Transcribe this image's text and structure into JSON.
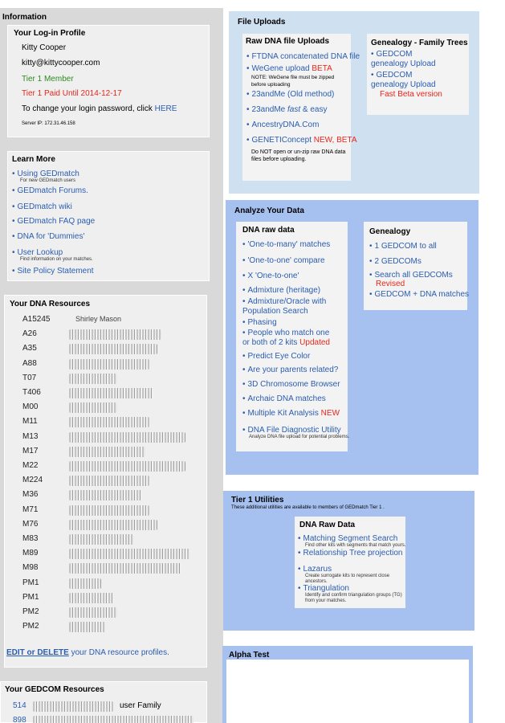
{
  "info": {
    "title": "Information"
  },
  "login": {
    "title": "Your Log-in Profile",
    "name": "Kitty Cooper",
    "email": "kitty@kittycooper.com",
    "tier": "Tier 1 Member",
    "paid": "Tier 1 Paid Until 2014-12-17",
    "pw_text": "To change your login password, click",
    "pw_link": "HERE",
    "server": "Server IP: 172.31.46.158"
  },
  "learn": {
    "title": "Learn More",
    "items": [
      {
        "label": "Using GEDmatch",
        "note": "For new GEDmatch users"
      },
      {
        "label": "GEDmatch Forums."
      },
      {
        "label": "GEDmatch wiki"
      },
      {
        "label": "GEDmatch FAQ page"
      },
      {
        "label": "DNA for 'Dummies'"
      },
      {
        "label": "User Lookup",
        "note": "Find information on your matches."
      },
      {
        "label": "Site Policy Statement"
      }
    ]
  },
  "dna_res": {
    "title": "Your DNA Resources",
    "kits": [
      "A15245",
      "A26",
      "A35",
      "A88",
      "T07",
      "T406",
      "M00",
      "M11",
      "M13",
      "M17",
      "M22",
      "M224",
      "M36",
      "M71",
      "M76",
      "M83",
      "M89",
      "M98",
      "PM1",
      "PM1",
      "PM2",
      "PM2"
    ],
    "first_name": "Shirley Mason",
    "edit_link": "EDIT or DELETE",
    "edit_text": "your DNA resource profiles."
  },
  "gedcom_res": {
    "title": "Your GEDCOM Resources",
    "rows": [
      "514",
      "898"
    ],
    "row1_tail": "user Family"
  },
  "uploads": {
    "title": "File Uploads",
    "raw": {
      "title": "Raw DNA file Uploads",
      "ftdna": "FTDNA concatenated DNA file",
      "wegene": "WeGene upload",
      "beta": "BETA",
      "wegene_note": "NOTE: WeGene file must be zipped before uploading",
      "andme_old": "23andMe (Old method)",
      "andme_fast_a": "23andMe",
      "andme_fast_b": "fast",
      "andme_fast_c": "& easy",
      "ancestry": "AncestryDNA.Com",
      "geneti": "GENETIConcept",
      "geneti_new": "NEW, BETA",
      "note": "Do NOT open or un-zip raw DNA data files before uploading."
    },
    "gen": {
      "title": "Genealogy - Family Trees",
      "gedcom_upload": "GEDCOM genealogy Upload",
      "gedcom_upload2": "GEDCOM genealogy Upload",
      "fast_beta": "Fast Beta version"
    }
  },
  "analyze": {
    "title": "Analyze Your Data",
    "raw": {
      "title": "DNA raw data",
      "items": [
        "'One-to-many' matches",
        "'One-to-one' compare",
        "X 'One-to-one'",
        "Admixture (heritage)",
        "Admixture/Oracle with Population Search",
        "Phasing",
        "People who match one or both of 2 kits",
        "Predict Eye Color",
        "Are your parents related?",
        "3D Chromosome Browser",
        "Archaic DNA matches",
        "Multiple Kit Analysis",
        "DNA File Diagnostic Utility"
      ],
      "updated": "Updated",
      "new": "NEW",
      "diag_note": "Analyze DNA file upload for potential problems."
    },
    "gen": {
      "title": "Genealogy",
      "items": [
        "1 GEDCOM to all",
        "2 GEDCOMs",
        "Search all GEDCOMs",
        "GEDCOM + DNA matches"
      ],
      "revised": "Revised"
    }
  },
  "tier1": {
    "title": "Tier 1 Utilities",
    "sub": "These additional utilities are available to members of GEDmatch Tier 1 .",
    "box_title": "DNA Raw Data",
    "items": [
      {
        "label": "Matching Segment Search",
        "note": "Find other kits with segments that match yours."
      },
      {
        "label": "Relationship Tree projection",
        "note": ""
      },
      {
        "label": "Lazarus",
        "note": "Create surrogate kits to represent close ancestors."
      },
      {
        "label": "Triangulation",
        "note": "Identify and confirm triangulation groups (TG) from your matches."
      }
    ]
  },
  "alpha": {
    "title": "Alpha Test"
  },
  "colors": {
    "link": "#2a5db0",
    "red": "#e8261c",
    "green": "#2e8b1e",
    "upload_bg": "#cfe0f1",
    "analyze_bg": "#a6c1f0"
  }
}
